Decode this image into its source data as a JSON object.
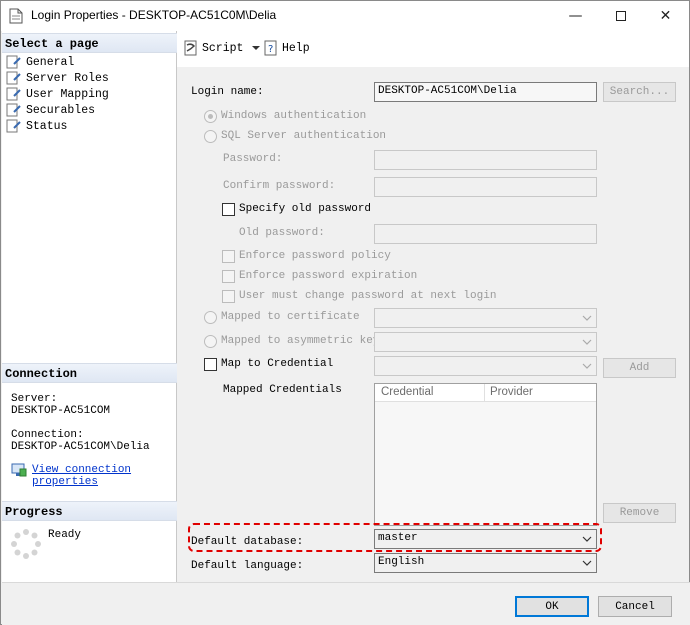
{
  "window": {
    "title": "Login Properties - DESKTOP-AC51C0M\\Delia"
  },
  "left": {
    "select_page_header": "Select a page",
    "pages": [
      {
        "label": "General"
      },
      {
        "label": "Server Roles"
      },
      {
        "label": "User Mapping"
      },
      {
        "label": "Securables"
      },
      {
        "label": "Status"
      }
    ],
    "connection_header": "Connection",
    "server_label": "Server:",
    "server_value": "DESKTOP-AC51COM",
    "connection_label": "Connection:",
    "connection_value": "DESKTOP-AC51COM\\Delia",
    "view_link_line1": "View connection",
    "view_link_line2": "properties",
    "progress_header": "Progress",
    "progress_status": "Ready"
  },
  "toolbar": {
    "script_label": "Script",
    "help_label": "Help"
  },
  "form": {
    "login_name_label": "Login name:",
    "login_name_value": "DESKTOP-AC51COM\\Delia",
    "search_button": "Search...",
    "windows_auth": "Windows authentication",
    "sql_auth": "SQL Server authentication",
    "password_label": "Password:",
    "confirm_password_label": "Confirm password:",
    "specify_old_password": "Specify old password",
    "old_password_label": "Old password:",
    "enforce_policy": "Enforce password policy",
    "enforce_expiration": "Enforce password expiration",
    "must_change": "User must change password at next login",
    "mapped_cert": "Mapped to certificate",
    "mapped_asym": "Mapped to asymmetric key",
    "map_credential": "Map to Credential",
    "add_button": "Add",
    "mapped_credentials_label": "Mapped Credentials",
    "grid_columns": [
      "Credential",
      "Provider"
    ],
    "remove_button": "Remove",
    "default_database_label": "Default database:",
    "default_database_value": "master",
    "default_language_label": "Default language:",
    "default_language_value": "English"
  },
  "footer": {
    "ok_button": "OK",
    "cancel_button": "Cancel"
  },
  "colors": {
    "highlight": "#e00000",
    "link": "#0033cc",
    "ok_border": "#0078d7"
  }
}
